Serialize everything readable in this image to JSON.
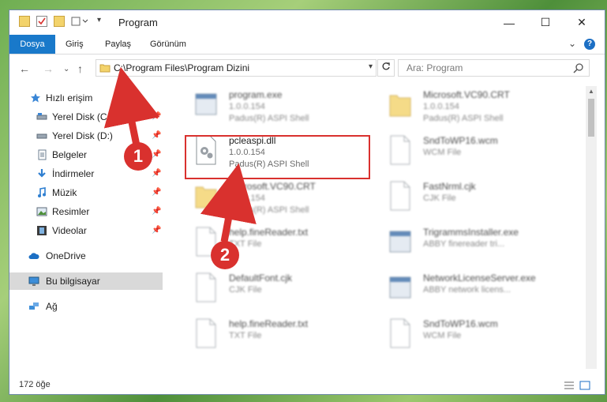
{
  "window": {
    "title": "Program",
    "minimize": "—",
    "maximize": "☐",
    "close": "✕"
  },
  "ribbon": {
    "tabs": [
      "Dosya",
      "Giriş",
      "Paylaş",
      "Görünüm"
    ],
    "help": "?"
  },
  "address": {
    "path": "C:\\Program Files\\Program Dizini"
  },
  "search": {
    "placeholder": "Ara: Program"
  },
  "sidebar": {
    "items": [
      {
        "label": "Hızlı erişim",
        "icon": "star-icon",
        "pinned": false
      },
      {
        "label": "Yerel Disk (C:)",
        "icon": "drive-icon",
        "pinned": true
      },
      {
        "label": "Yerel Disk (D:)",
        "icon": "drive-icon",
        "pinned": true
      },
      {
        "label": "Belgeler",
        "icon": "documents-icon",
        "pinned": true
      },
      {
        "label": "İndirmeler",
        "icon": "download-icon",
        "pinned": true
      },
      {
        "label": "Müzik",
        "icon": "music-icon",
        "pinned": true
      },
      {
        "label": "Resimler",
        "icon": "pictures-icon",
        "pinned": true
      },
      {
        "label": "Videolar",
        "icon": "video-icon",
        "pinned": true
      },
      {
        "label": "OneDrive",
        "icon": "cloud-icon",
        "pinned": false
      },
      {
        "label": "Bu bilgisayar",
        "icon": "computer-icon",
        "pinned": false,
        "selected": true
      },
      {
        "label": "Ağ",
        "icon": "network-icon",
        "pinned": false
      }
    ]
  },
  "files": [
    {
      "name": "program.exe",
      "line2": "1.0.0.154",
      "line3": "Padus(R) ASPI Shell",
      "icon": "exe-icon"
    },
    {
      "name": "Microsoft.VC90.CRT",
      "line2": "1.0.0.154",
      "line3": "Padus(R) ASPI Shell",
      "icon": "folder-icon"
    },
    {
      "name": "pcleaspi.dll",
      "line2": "1.0.0.154",
      "line3": "Padus(R) ASPI Shell",
      "icon": "dll-icon"
    },
    {
      "name": "SndToWP16.wcm",
      "line2": "WCM File",
      "line3": "",
      "icon": "file-icon"
    },
    {
      "name": "Microsoft.VC90.CRT",
      "line2": "1.0.0.154",
      "line3": "Padus(R) ASPI Shell",
      "icon": "folder-icon"
    },
    {
      "name": "FastNrml.cjk",
      "line2": "CJK File",
      "line3": "",
      "icon": "file-icon"
    },
    {
      "name": "help.fineReader.txt",
      "line2": "TXT File",
      "line3": "",
      "icon": "file-icon"
    },
    {
      "name": "TrigrammsInstaller.exe",
      "line2": "ABBY finereader tri...",
      "line3": "",
      "icon": "exe-icon"
    },
    {
      "name": "DefaultFont.cjk",
      "line2": "CJK File",
      "line3": "",
      "icon": "file-icon"
    },
    {
      "name": "NetworkLicenseServer.exe",
      "line2": "ABBY network licens...",
      "line3": "",
      "icon": "exe-icon"
    },
    {
      "name": "help.fineReader.txt",
      "line2": "TXT File",
      "line3": "",
      "icon": "file-icon"
    },
    {
      "name": "SndToWP16.wcm",
      "line2": "WCM File",
      "line3": "",
      "icon": "file-icon"
    }
  ],
  "status": {
    "count": "172 öğe"
  },
  "annotations": {
    "step1": "1",
    "step2": "2"
  },
  "colors": {
    "accent": "#1979ca",
    "highlight": "#d9312e",
    "selected": "#d9d9d9"
  }
}
